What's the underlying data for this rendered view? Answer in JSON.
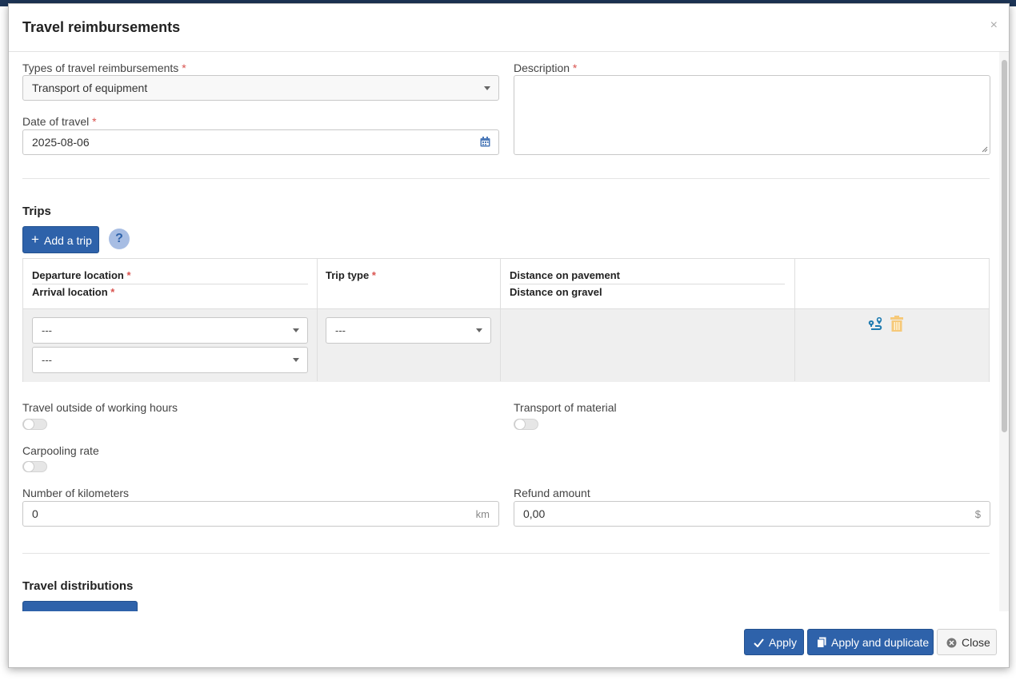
{
  "modal": {
    "title": "Travel reimbursements",
    "close_glyph": "×"
  },
  "form": {
    "type_label": "Types of travel reimbursements",
    "type_value": "Transport of equipment",
    "date_label": "Date of travel",
    "date_value": "2025-08-06",
    "description_label": "Description",
    "required_mark": "*"
  },
  "trips": {
    "title": "Trips",
    "add_button": "Add a trip",
    "add_icon": "+",
    "help_glyph": "?",
    "headers": {
      "departure": "Departure location",
      "arrival": "Arrival location",
      "trip_type": "Trip type",
      "distance_pavement": "Distance on pavement",
      "distance_gravel": "Distance on gravel"
    },
    "row": {
      "departure_value": "---",
      "arrival_value": "---",
      "trip_type_value": "---"
    }
  },
  "toggles": {
    "outside_hours": "Travel outside of working hours",
    "transport_material": "Transport of material",
    "carpooling": "Carpooling rate"
  },
  "totals": {
    "km_label": "Number of kilometers",
    "km_value": "0",
    "km_suffix": "km",
    "refund_label": "Refund amount",
    "refund_value": "0,00",
    "refund_suffix": "$"
  },
  "distributions": {
    "title": "Travel distributions"
  },
  "footer": {
    "apply": "Apply",
    "apply_duplicate": "Apply and duplicate",
    "close": "Close"
  },
  "colors": {
    "primary": "#2e62aa",
    "required": "#d9534f",
    "route_icon": "#1f7bb0",
    "trash_icon": "#f6c979"
  }
}
